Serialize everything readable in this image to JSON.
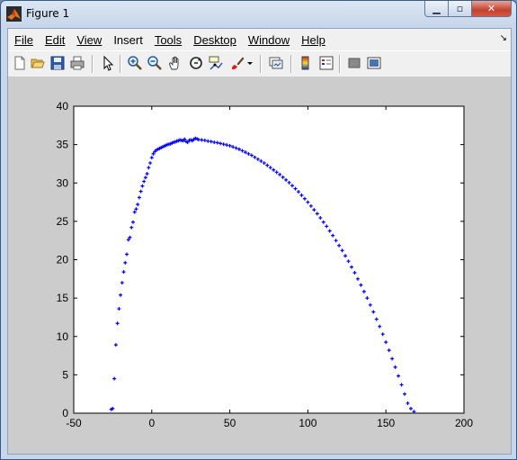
{
  "window": {
    "title": "Figure 1"
  },
  "menu": [
    {
      "label": "File"
    },
    {
      "label": "Edit"
    },
    {
      "label": "View"
    },
    {
      "label": "Insert"
    },
    {
      "label": "Tools"
    },
    {
      "label": "Desktop"
    },
    {
      "label": "Window"
    },
    {
      "label": "Help"
    }
  ],
  "toolbar": {
    "icons": [
      "new-figure-icon",
      "open-file-icon",
      "save-icon",
      "print-icon",
      "edit-plot-arrow-icon",
      "zoom-in-icon",
      "zoom-out-icon",
      "pan-hand-icon",
      "rotate-3d-icon",
      "data-cursor-icon",
      "brush-icon",
      "brush-dropdown-icon",
      "link-plot-icon",
      "colorbar-icon",
      "legend-icon",
      "hide-plot-tools-icon",
      "show-plot-tools-icon"
    ]
  },
  "chart_data": {
    "type": "scatter",
    "marker": "+",
    "color": "#0000ff",
    "xlim": [
      -50,
      200
    ],
    "ylim": [
      0,
      40
    ],
    "xticks": [
      -50,
      0,
      50,
      100,
      150,
      200
    ],
    "yticks": [
      0,
      5,
      10,
      15,
      20,
      25,
      30,
      35,
      40
    ],
    "grid": false,
    "series": [
      {
        "points": [
          [
            -26,
            0.5
          ],
          [
            -25,
            0.6
          ],
          [
            -24,
            4.5
          ],
          [
            -23,
            8.9
          ],
          [
            -22,
            11.7
          ],
          [
            -21,
            13.6
          ],
          [
            -20,
            15.4
          ],
          [
            -19,
            17.0
          ],
          [
            -18,
            18.4
          ],
          [
            -17,
            19.6
          ],
          [
            -16,
            20.7
          ],
          [
            -15,
            22.6
          ],
          [
            -14,
            22.9
          ],
          [
            -13,
            24.2
          ],
          [
            -12,
            24.9
          ],
          [
            -11,
            26.2
          ],
          [
            -10,
            26.6
          ],
          [
            -9,
            27.2
          ],
          [
            -8,
            28.1
          ],
          [
            -7,
            28.9
          ],
          [
            -6,
            29.6
          ],
          [
            -5,
            30.2
          ],
          [
            -4,
            30.7
          ],
          [
            -3,
            31.2
          ],
          [
            -2,
            32.0
          ],
          [
            -1,
            32.6
          ],
          [
            0,
            33.3
          ],
          [
            1,
            33.8
          ],
          [
            2,
            34.1
          ],
          [
            3,
            34.3
          ],
          [
            4,
            34.4
          ],
          [
            5,
            34.5
          ],
          [
            6,
            34.6
          ],
          [
            7,
            34.7
          ],
          [
            8,
            34.8
          ],
          [
            9,
            34.9
          ],
          [
            10,
            35.0
          ],
          [
            11,
            35.05
          ],
          [
            12,
            35.1
          ],
          [
            13,
            35.2
          ],
          [
            14,
            35.3
          ],
          [
            15,
            35.35
          ],
          [
            16,
            35.45
          ],
          [
            17,
            35.5
          ],
          [
            18,
            35.6
          ],
          [
            19,
            35.55
          ],
          [
            20,
            35.5
          ],
          [
            21,
            35.7
          ],
          [
            22,
            35.4
          ],
          [
            23,
            35.3
          ],
          [
            24,
            35.55
          ],
          [
            25,
            35.6
          ],
          [
            26,
            35.5
          ],
          [
            27,
            35.7
          ],
          [
            28,
            35.8
          ],
          [
            29,
            35.75
          ],
          [
            30,
            35.65
          ],
          [
            32,
            35.6
          ],
          [
            34,
            35.55
          ],
          [
            36,
            35.45
          ],
          [
            38,
            35.4
          ],
          [
            40,
            35.3
          ],
          [
            42,
            35.25
          ],
          [
            44,
            35.15
          ],
          [
            46,
            35.05
          ],
          [
            48,
            34.95
          ],
          [
            50,
            34.85
          ],
          [
            52,
            34.7
          ],
          [
            54,
            34.55
          ],
          [
            56,
            34.4
          ],
          [
            58,
            34.2
          ],
          [
            60,
            34.0
          ],
          [
            62,
            33.8
          ],
          [
            64,
            33.6
          ],
          [
            66,
            33.35
          ],
          [
            68,
            33.1
          ],
          [
            70,
            32.85
          ],
          [
            72,
            32.6
          ],
          [
            74,
            32.3
          ],
          [
            76,
            32.0
          ],
          [
            78,
            31.7
          ],
          [
            80,
            31.4
          ],
          [
            82,
            31.1
          ],
          [
            84,
            30.75
          ],
          [
            86,
            30.4
          ],
          [
            88,
            30.05
          ],
          [
            90,
            29.65
          ],
          [
            92,
            29.25
          ],
          [
            94,
            28.85
          ],
          [
            96,
            28.4
          ],
          [
            98,
            27.95
          ],
          [
            100,
            27.5
          ],
          [
            102,
            27.0
          ],
          [
            104,
            26.5
          ],
          [
            106,
            26.0
          ],
          [
            108,
            25.45
          ],
          [
            110,
            24.9
          ],
          [
            112,
            24.35
          ],
          [
            114,
            23.75
          ],
          [
            116,
            23.15
          ],
          [
            118,
            22.5
          ],
          [
            120,
            21.85
          ],
          [
            122,
            21.2
          ],
          [
            124,
            20.5
          ],
          [
            126,
            19.8
          ],
          [
            128,
            19.05
          ],
          [
            130,
            18.3
          ],
          [
            132,
            17.5
          ],
          [
            134,
            16.7
          ],
          [
            136,
            15.85
          ],
          [
            138,
            15.0
          ],
          [
            140,
            14.1
          ],
          [
            142,
            13.2
          ],
          [
            144,
            12.25
          ],
          [
            146,
            11.3
          ],
          [
            148,
            10.3
          ],
          [
            150,
            9.25
          ],
          [
            152,
            8.2
          ],
          [
            154,
            7.1
          ],
          [
            156,
            6.0
          ],
          [
            158,
            4.85
          ],
          [
            160,
            3.7
          ],
          [
            162,
            2.5
          ],
          [
            164,
            1.3
          ],
          [
            166,
            0.6
          ],
          [
            168,
            0.2
          ]
        ]
      }
    ]
  }
}
